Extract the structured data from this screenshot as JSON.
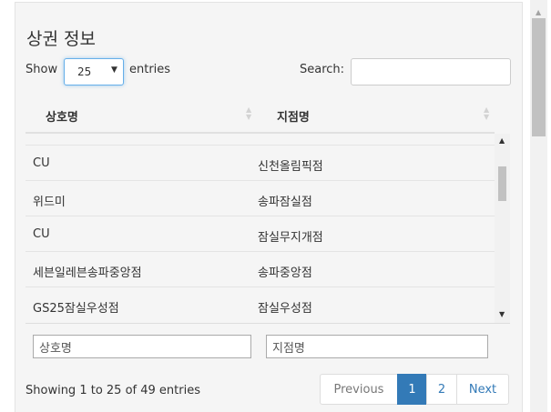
{
  "panel": {
    "title": "상권 정보"
  },
  "length": {
    "show_label": "Show",
    "value": "25",
    "entries_label": "entries"
  },
  "search": {
    "label": "Search:",
    "value": ""
  },
  "table": {
    "columns": [
      "상호명",
      "지점명"
    ],
    "rows": [
      [
        "CU",
        "신천올림픽점"
      ],
      [
        "위드미",
        "송파잠실점"
      ],
      [
        "CU",
        "잠실무지개점"
      ],
      [
        "세븐일레븐송파중앙점",
        "송파중앙점"
      ],
      [
        "GS25잠실우성점",
        "잠실우성점"
      ]
    ],
    "filters": [
      "상호명",
      "지점명"
    ]
  },
  "footer": {
    "info": "Showing 1 to 25 of 49 entries",
    "previous": "Previous",
    "pages": [
      "1",
      "2"
    ],
    "active_page": "1",
    "next": "Next"
  },
  "icons": {
    "dropdown": "caret-down-icon",
    "sort": "sort-both-icon",
    "scroll_up": "arrow-up-icon",
    "scroll_down": "arrow-down-icon"
  },
  "colors": {
    "accent": "#337ab7",
    "focus_border": "#66afe9",
    "panel_bg": "#f5f5f5"
  }
}
